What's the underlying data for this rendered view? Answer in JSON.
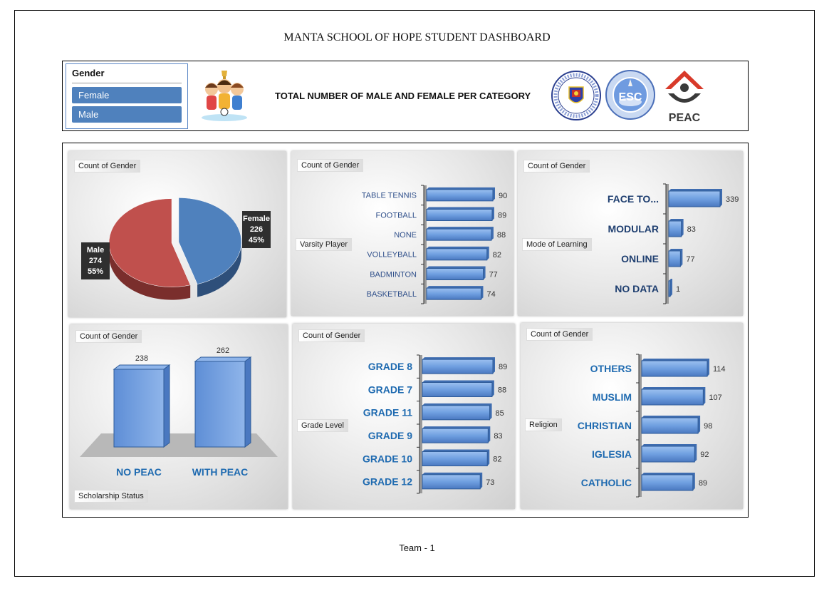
{
  "title": "MANTA SCHOOL OF HOPE STUDENT DASHBOARD",
  "header_text": "TOTAL NUMBER OF MALE AND FEMALE PER CATEGORY",
  "slicer": {
    "title": "Gender",
    "items": [
      "Female",
      "Male"
    ]
  },
  "logos": {
    "peac_text": "PEAC"
  },
  "footer": "Team - 1",
  "colors": {
    "female": "#4f81bd",
    "male": "#c0504d",
    "bar": "#6f9fe0",
    "category_text": "#1f4e8c"
  },
  "chart_data": [
    {
      "type": "pie",
      "field_button": "Count of Gender",
      "categories": [
        "Female",
        "Male"
      ],
      "values": [
        226,
        274
      ],
      "percent_labels": [
        "45%",
        "55%"
      ]
    },
    {
      "type": "bar",
      "field_button": "Count of Gender",
      "axis_field": "Varsity Player",
      "categories": [
        "TABLE TENNIS",
        "FOOTBALL",
        "NONE",
        "VOLLEYBALL",
        "BADMINTON",
        "BASKETBALL"
      ],
      "values": [
        90,
        89,
        88,
        82,
        77,
        74
      ]
    },
    {
      "type": "bar",
      "field_button": "Count of Gender",
      "axis_field": "Mode of Learning",
      "categories": [
        "FACE TO...",
        "MODULAR",
        "ONLINE",
        "NO DATA"
      ],
      "values": [
        339,
        83,
        77,
        1
      ]
    },
    {
      "type": "bar",
      "orientation": "vertical",
      "field_button": "Count of Gender",
      "axis_field": "Scholarship Status",
      "categories": [
        "NO PEAC",
        "WITH PEAC"
      ],
      "values": [
        238,
        262
      ]
    },
    {
      "type": "bar",
      "field_button": "Count of Gender",
      "axis_field": "Grade Level",
      "categories": [
        "GRADE 8",
        "GRADE 7",
        "GRADE 11",
        "GRADE 9",
        "GRADE 10",
        "GRADE 12"
      ],
      "values": [
        89,
        88,
        85,
        83,
        82,
        73
      ]
    },
    {
      "type": "bar",
      "field_button": "Count of Gender",
      "axis_field": "Religion",
      "categories": [
        "OTHERS",
        "MUSLIM",
        "CHRISTIAN",
        "IGLESIA",
        "CATHOLIC"
      ],
      "values": [
        114,
        107,
        98,
        92,
        89
      ]
    }
  ]
}
